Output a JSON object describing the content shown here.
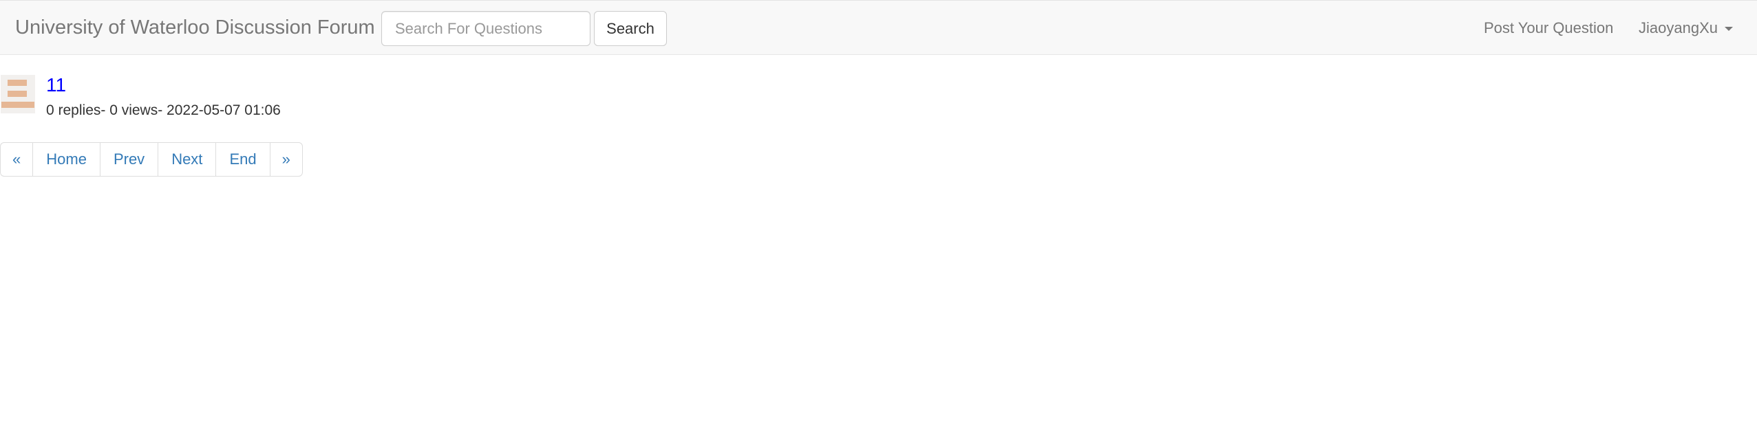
{
  "navbar": {
    "brand": "University of Waterloo Discussion Forum",
    "search_placeholder": "Search For Questions",
    "search_value": "",
    "search_button": "Search",
    "post_question": "Post Your Question",
    "username": "JiaoyangXu"
  },
  "posts": [
    {
      "title": "11",
      "meta": "0 replies- 0 views- 2022-05-07 01:06",
      "avatar_color": "#e6b795"
    }
  ],
  "pagination": {
    "first": "«",
    "home": "Home",
    "prev": "Prev",
    "next": "Next",
    "end": "End",
    "last": "»"
  },
  "colors": {
    "navbar_bg": "#f8f8f8",
    "link": "#337ab7",
    "post_title": "#0000ff"
  }
}
